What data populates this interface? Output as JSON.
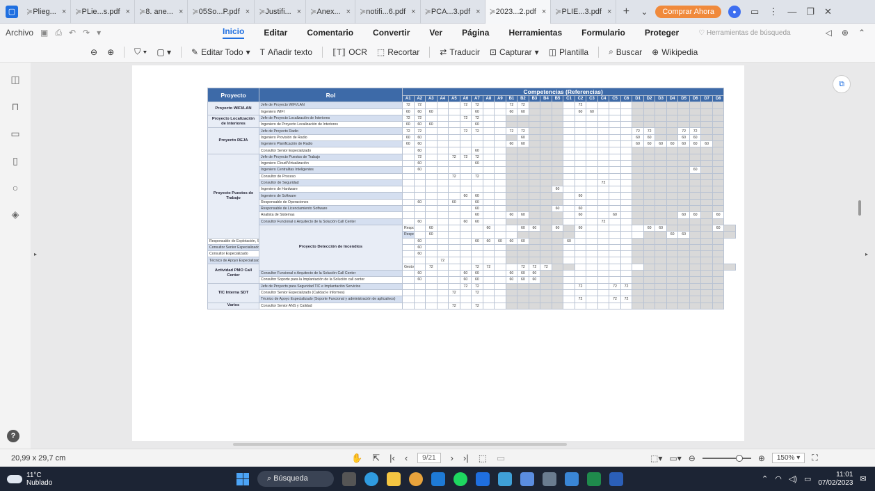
{
  "tabs": [
    {
      "label": "Plieg..."
    },
    {
      "label": "PLie...s.pdf"
    },
    {
      "label": "8. ane..."
    },
    {
      "label": "05So...P.pdf"
    },
    {
      "label": "Justifi..."
    },
    {
      "label": "Anex..."
    },
    {
      "label": "notifi...6.pdf"
    },
    {
      "label": "PCA...3.pdf"
    },
    {
      "label": "2023...2.pdf"
    },
    {
      "label": "PLIE...3.pdf"
    }
  ],
  "tab_close": "×",
  "buy_button": "Comprar Ahora",
  "menu": {
    "archivo": "Archivo",
    "items": [
      "Inicio",
      "Editar",
      "Comentario",
      "Convertir",
      "Ver",
      "Página",
      "Herramientas",
      "Formulario",
      "Proteger"
    ],
    "tool_search": "Herramientas de búsqueda"
  },
  "toolbar": {
    "editar_todo": "Editar Todo",
    "anadir_texto": "Añadir texto",
    "ocr": "OCR",
    "recortar": "Recortar",
    "traducir": "Traducir",
    "capturar": "Capturar",
    "plantilla": "Plantilla",
    "buscar": "Buscar",
    "wikipedia": "Wikipedia"
  },
  "table": {
    "header_proyecto": "Proyecto",
    "header_rol": "Rol",
    "header_comp": "Competencias (Referencias)",
    "codes": [
      "A1",
      "A2",
      "A3",
      "A4",
      "A5",
      "A6",
      "A7",
      "A8",
      "A9",
      "B1",
      "B2",
      "B3",
      "B4",
      "B5",
      "C1",
      "C2",
      "C3",
      "C4",
      "C5",
      "C6",
      "D1",
      "D2",
      "D3",
      "D4",
      "D5",
      "D6",
      "D7",
      "D8"
    ],
    "rows": [
      {
        "proj": "Proyecto WIFI/LAN",
        "span": 2,
        "rol": "Jefe de Proyecto WIFI/LAN",
        "v": {
          "0": "72",
          "1": "72",
          "5": "72",
          "6": "72",
          "9": "72",
          "10": "72",
          "15": "72"
        }
      },
      {
        "rol": "Ingeniero WIFI",
        "v": {
          "0": "60",
          "1": "60",
          "2": "60",
          "6": "60",
          "9": "60",
          "10": "60",
          "15": "60",
          "16": "60"
        }
      },
      {
        "proj": "Proyecto Localización de Interiores",
        "span": 2,
        "rol": "Jefe de Proyecto Localización de Interiores",
        "v": {
          "0": "72",
          "1": "72",
          "5": "72",
          "6": "72"
        }
      },
      {
        "rol": "Ingeniero de Proyecto Localización de Interiores",
        "v": {
          "0": "60",
          "1": "60",
          "2": "60",
          "6": "60"
        }
      },
      {
        "proj": "Proyecto REJA",
        "span": 4,
        "rol": "Jefe de Proyecto Radio",
        "v": {
          "0": "72",
          "1": "72",
          "5": "72",
          "6": "72",
          "9": "72",
          "10": "72",
          "20": "72",
          "21": "72",
          "24": "72",
          "25": "72"
        }
      },
      {
        "rol": "Ingeniero Provisión de Radio",
        "v": {
          "0": "60",
          "1": "60",
          "10": "60",
          "20": "60",
          "21": "60",
          "24": "60",
          "25": "60"
        }
      },
      {
        "rol": "Ingeniero Planificación de Radio",
        "v": {
          "0": "60",
          "1": "60",
          "9": "60",
          "10": "60",
          "20": "60",
          "21": "60",
          "22": "60",
          "23": "60",
          "24": "60",
          "25": "60",
          "26": "60"
        }
      },
      {
        "rol": "Consultor Senior Especializado",
        "v": {
          "1": "60",
          "6": "60"
        }
      },
      {
        "proj": "Proyecto Puestos de Trabajo",
        "span": 13,
        "rol": "Jefe de Proyecto Puestos de Trabajo",
        "v": {
          "1": "72",
          "4": "72",
          "5": "72",
          "6": "72"
        }
      },
      {
        "rol": "Ingeniero Cloud/Virtualización",
        "v": {
          "1": "60",
          "6": "60"
        }
      },
      {
        "rol": "Ingeniero Centralitas Inteligentes",
        "v": {
          "1": "60",
          "25": "60"
        }
      },
      {
        "rol": "Consultor de Proceso",
        "v": {
          "4": "72",
          "6": "72"
        }
      },
      {
        "rol": "Consultor de Seguridad",
        "v": {
          "17": "72"
        }
      },
      {
        "rol": "Ingeniero de Hardware",
        "v": {
          "13": "60"
        }
      },
      {
        "rol": "Ingeniero de Software",
        "v": {
          "5": "60",
          "6": "60",
          "15": "60"
        }
      },
      {
        "rol": "Responsable de Operaciones",
        "v": {
          "1": "60",
          "4": "60",
          "6": "60"
        }
      },
      {
        "rol": "Responsable de Licenciamiento Software",
        "v": {
          "6": "60",
          "13": "60",
          "15": "60"
        }
      },
      {
        "rol": "Analista de Sistemas",
        "v": {
          "6": "60",
          "9": "60",
          "10": "60",
          "15": "60",
          "18": "60",
          "24": "60",
          "25": "60",
          "27": "60"
        }
      },
      {
        "rol": "Consultor Funcional o Arquitecto de la Solución Call Center",
        "v": {
          "1": "60",
          "5": "60",
          "6": "60",
          "17": "72"
        }
      },
      {
        "proj": "Proyecto Detección de Incendios",
        "span": 7,
        "rol": "Responsable de Diseños Técnicos",
        "v": {
          "1": "60",
          "6": "60",
          "9": "60",
          "10": "60",
          "12": "60",
          "14": "60",
          "20": "60",
          "21": "60",
          "26": "60"
        }
      },
      {
        "rol": "Responsable de Adecuación y Provisión",
        "v": {
          "1": "60",
          "22": "60",
          "23": "60"
        }
      },
      {
        "rol": "Responsable de Explotación, Supervisión y Mantenimiento",
        "v": {
          "1": "60",
          "6": "60",
          "7": "60",
          "8": "60",
          "9": "60",
          "10": "60",
          "14": "60"
        }
      },
      {
        "rol": "Consultor Senior Especializado",
        "v": {
          "1": "60"
        }
      },
      {
        "rol": "Consultor Especializado",
        "v": {
          "1": "60"
        }
      },
      {
        "rol": "Técnico de Apoyo Especializado",
        "v": {
          "3": "72"
        }
      },
      {
        "proj": "Actividad PMO Call Center",
        "span": 3,
        "rol": "Gestor de Proyecto PMO Call Center",
        "v": {
          "1": "72",
          "5": "72",
          "6": "72",
          "9": "72",
          "10": "72",
          "11": "72"
        }
      },
      {
        "rol": "Consultor Funcional o Arquitecto de la Solución Call Center",
        "v": {
          "1": "60",
          "5": "60",
          "6": "60",
          "9": "60",
          "10": "60",
          "11": "60"
        }
      },
      {
        "rol": "Consultor Soporte para la Implantación de la Solución call center",
        "v": {
          "1": "60",
          "5": "60",
          "6": "60",
          "9": "60",
          "10": "60",
          "11": "60"
        }
      },
      {
        "proj": "TIC Interna SDT",
        "span": 3,
        "rol": "Jefe de Proyecto para Seguridad TIC e Implantación Servicios",
        "v": {
          "5": "72",
          "6": "72",
          "15": "72",
          "18": "72",
          "19": "72"
        }
      },
      {
        "rol": "Consultor Senior Especializado (Calidad e Informes)",
        "v": {
          "4": "72",
          "6": "72"
        }
      },
      {
        "rol": "Técnico de Apoyo Especializado (Soporte Funcional y administración de aplicativos)",
        "v": {
          "15": "72",
          "18": "72",
          "19": "72"
        }
      },
      {
        "proj": "Varios",
        "span": 1,
        "rol": "Consultor Senior ANS y Calidad",
        "v": {
          "4": "72",
          "6": "72"
        }
      }
    ]
  },
  "status": {
    "dimensions": "20,99 x 29,7 cm",
    "page_input": "9/21",
    "zoom": "150%"
  },
  "taskbar": {
    "temp": "11°C",
    "weather": "Nublado",
    "search": "Búsqueda",
    "time": "11:01",
    "date": "07/02/2023"
  }
}
